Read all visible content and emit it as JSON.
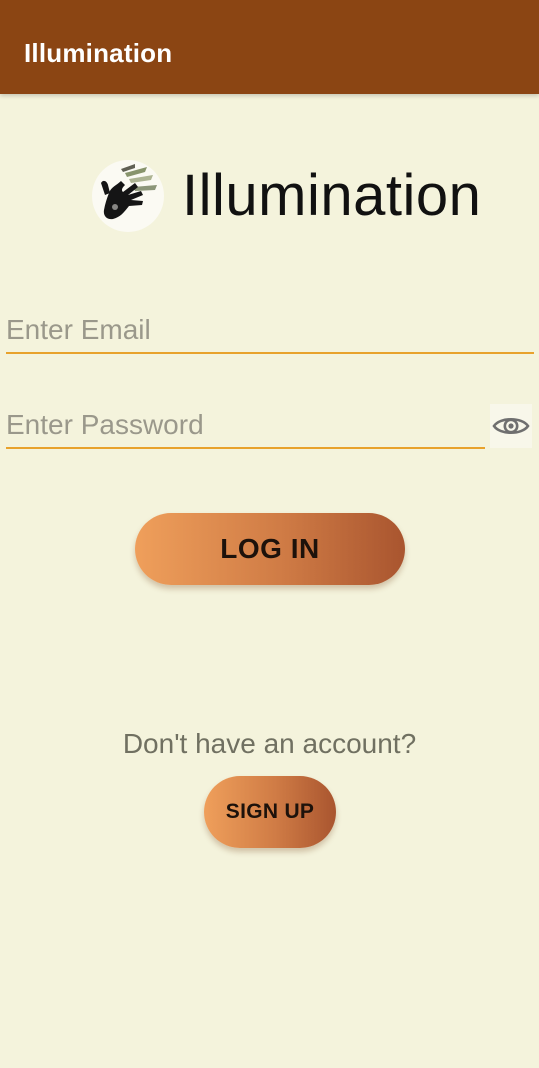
{
  "app_bar": {
    "title": "Illumination"
  },
  "logo": {
    "icon": "hand-sign-icon",
    "text": "Illumination"
  },
  "form": {
    "email": {
      "placeholder": "Enter Email",
      "value": ""
    },
    "password": {
      "placeholder": "Enter Password",
      "value": "",
      "toggle_icon": "eye-icon"
    },
    "login_label": "LOG IN"
  },
  "signup": {
    "prompt": "Don't have an account?",
    "button_label": "SIGN UP"
  },
  "colors": {
    "app_bar": "#8b4513",
    "background": "#f4f3dc",
    "field_underline": "#e8a22c",
    "button_gradient_start": "#ef9f5b",
    "button_gradient_end": "#a9552f"
  }
}
